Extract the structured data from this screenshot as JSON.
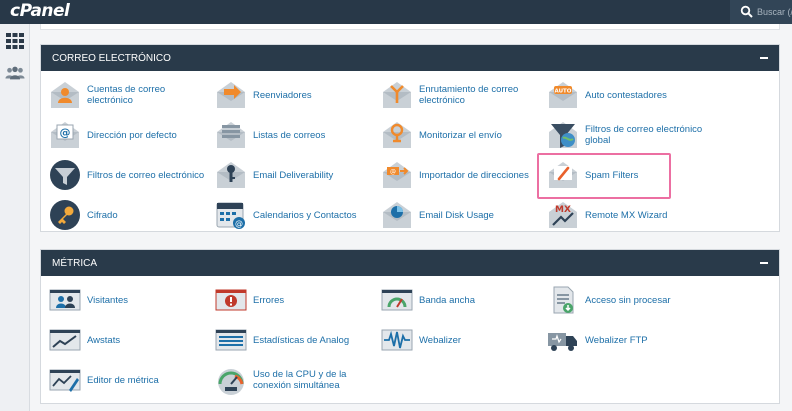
{
  "header": {
    "logo": "cPanel",
    "search_placeholder": "Buscar (/"
  },
  "sections": [
    {
      "title": "CORREO ELECTRÓNICO",
      "items": [
        {
          "label": "Cuentas de correo electrónico",
          "icon": "email-accounts-icon"
        },
        {
          "label": "Reenviadores",
          "icon": "forwarders-icon"
        },
        {
          "label": "Enrutamiento de correo electrónico",
          "icon": "email-routing-icon"
        },
        {
          "label": "Auto contestadores",
          "icon": "autoresponders-icon"
        },
        {
          "label": "Dirección por defecto",
          "icon": "default-address-icon"
        },
        {
          "label": "Listas de correos",
          "icon": "mailing-lists-icon"
        },
        {
          "label": "Monitorizar el envío",
          "icon": "track-delivery-icon"
        },
        {
          "label": "Filtros de correo electrónico global",
          "icon": "global-email-filters-icon"
        },
        {
          "label": "Filtros de correo electrónico",
          "icon": "email-filters-icon"
        },
        {
          "label": "Email Deliverability",
          "icon": "email-deliverability-icon"
        },
        {
          "label": "Importador de direcciones",
          "icon": "address-importer-icon"
        },
        {
          "label": "Spam Filters",
          "icon": "spam-filters-icon"
        },
        {
          "label": "Cifrado",
          "icon": "encryption-key-icon"
        },
        {
          "label": "Calendarios y Contactos",
          "icon": "calendars-contacts-icon"
        },
        {
          "label": "Email Disk Usage",
          "icon": "email-disk-usage-icon"
        },
        {
          "label": "Remote MX Wizard",
          "icon": "remote-mx-wizard-icon"
        }
      ]
    },
    {
      "title": "MÉTRICA",
      "items": [
        {
          "label": "Visitantes",
          "icon": "visitors-icon"
        },
        {
          "label": "Errores",
          "icon": "errors-icon"
        },
        {
          "label": "Banda ancha",
          "icon": "bandwidth-icon"
        },
        {
          "label": "Acceso sin procesar",
          "icon": "raw-access-icon"
        },
        {
          "label": "Awstats",
          "icon": "awstats-icon"
        },
        {
          "label": "Estadísticas de Analog",
          "icon": "analog-stats-icon"
        },
        {
          "label": "Webalizer",
          "icon": "webalizer-icon"
        },
        {
          "label": "Webalizer FTP",
          "icon": "webalizer-ftp-icon"
        },
        {
          "label": "Editor de métrica",
          "icon": "metrics-editor-icon"
        },
        {
          "label": "Uso de la CPU y de la conexión simultánea",
          "icon": "cpu-usage-icon"
        }
      ]
    }
  ],
  "colors": {
    "header_bg": "#293a4a",
    "link": "#1d6fa8",
    "highlight": "#ec6fa2"
  }
}
